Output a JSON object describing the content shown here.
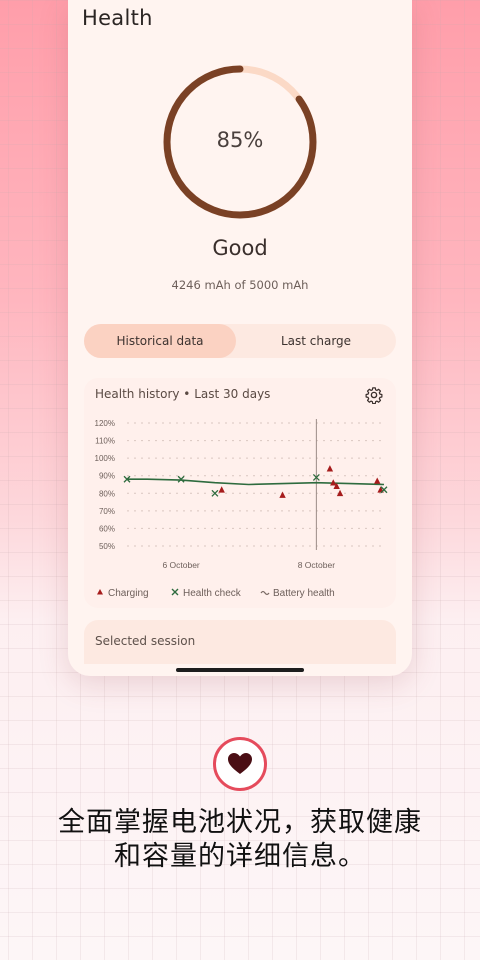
{
  "screen": {
    "title": "Health",
    "ring_percent_label": "85%",
    "ring_value": 0.85,
    "status": "Good",
    "capacity": "4246 mAh of 5000 mAh"
  },
  "tabs": [
    {
      "label": "Historical data",
      "active": true
    },
    {
      "label": "Last charge",
      "active": false
    }
  ],
  "card": {
    "title": "Health history • Last 30 days",
    "settings_icon": "gear-icon"
  },
  "chart_data": {
    "type": "line",
    "title": "Health history • Last 30 days",
    "xlabel": "",
    "ylabel": "",
    "ylim": [
      50,
      120
    ],
    "y_ticks": [
      "120%",
      "110%",
      "100%",
      "90%",
      "80%",
      "70%",
      "60%",
      "50%"
    ],
    "x_tick_labels": [
      "6 October",
      "8 October"
    ],
    "x_range_days": [
      5.2,
      9.0
    ],
    "x_tick_positions": [
      6,
      8
    ],
    "vertical_marker_x": 8,
    "grid": true,
    "legend_position": "bottom",
    "series": [
      {
        "name": "Battery health",
        "kind": "line",
        "color": "#2e6b3e",
        "points": [
          [
            5.2,
            88
          ],
          [
            5.5,
            88
          ],
          [
            6.0,
            87.5
          ],
          [
            6.5,
            86
          ],
          [
            7.0,
            85
          ],
          [
            7.5,
            85.5
          ],
          [
            8.0,
            86
          ],
          [
            8.5,
            85.5
          ],
          [
            9.0,
            85
          ]
        ]
      },
      {
        "name": "Charging",
        "kind": "scatter",
        "marker": "triangle",
        "color": "#a61c1c",
        "points": [
          [
            6.6,
            82
          ],
          [
            7.5,
            79
          ],
          [
            8.9,
            87
          ],
          [
            8.2,
            94
          ],
          [
            8.25,
            86
          ],
          [
            8.3,
            84
          ],
          [
            8.35,
            80
          ],
          [
            8.95,
            82
          ]
        ]
      },
      {
        "name": "Health check",
        "kind": "scatter",
        "marker": "x",
        "color": "#2e6b3e",
        "points": [
          [
            5.2,
            88
          ],
          [
            6.0,
            88
          ],
          [
            6.5,
            80
          ],
          [
            8.0,
            89
          ],
          [
            9.0,
            82
          ]
        ]
      }
    ],
    "legend": [
      {
        "label": "Charging",
        "marker": "triangle",
        "color": "#a61c1c"
      },
      {
        "label": "Health check",
        "marker": "x",
        "color": "#2e6b3e"
      },
      {
        "label": "Battery health",
        "marker": "wave",
        "color": "#7a6a64"
      }
    ]
  },
  "selected_session": {
    "label": "Selected session"
  },
  "caption": {
    "line1": "全面掌握电池状况，获取健康",
    "line2": "和容量的详细信息。"
  },
  "colors": {
    "ring_fill": "#7a4125",
    "ring_track": "#fbd9c6",
    "accent_red": "#e54b5c",
    "heart": "#4a0e14"
  }
}
